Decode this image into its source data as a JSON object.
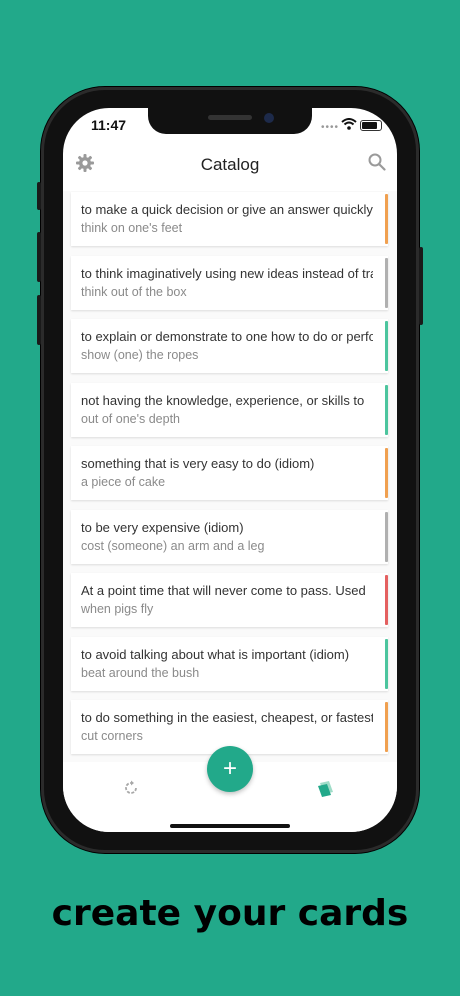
{
  "status_bar": {
    "time": "11:47",
    "signal_dots": "••••"
  },
  "header": {
    "title": "Catalog",
    "settings_icon": "gear-icon",
    "search_icon": "search-icon"
  },
  "cards": [
    {
      "definition": "to make a quick decision or give an answer quickly",
      "term": "think on one's feet",
      "color": "#f0a050"
    },
    {
      "definition": "to think imaginatively using new ideas instead of traditional ones",
      "term": "think out of the box",
      "color": "#b0b0b0"
    },
    {
      "definition": "to explain or demonstrate to one how to do or perform",
      "term": "show (one) the ropes",
      "color": "#4cc59e"
    },
    {
      "definition": "not having the knowledge, experience, or skills to",
      "term": "out of one's depth",
      "color": "#4cc59e"
    },
    {
      "definition": "something that is very easy to do (idiom)",
      "term": "a piece of cake",
      "color": "#f0a050"
    },
    {
      "definition": "to be very expensive (idiom)",
      "term": "cost (someone) an arm and a leg",
      "color": "#b0b0b0"
    },
    {
      "definition": "At a point time that will never come to pass. Used",
      "term": "when pigs fly",
      "color": "#e46060"
    },
    {
      "definition": "to avoid talking about what is important (idiom)",
      "term": "beat around the bush",
      "color": "#4cc59e"
    },
    {
      "definition": "to do something in the easiest, cheapest, or fastest way",
      "term": "cut corners",
      "color": "#f0a050"
    },
    {
      "definition": "",
      "term": "",
      "color": "#b0b0b0"
    }
  ],
  "fab": {
    "label": "+"
  },
  "tabbar": {
    "left_icon": "refresh-icon",
    "right_icon": "cards-icon"
  },
  "caption": "create your cards",
  "colors": {
    "brand": "#22a98a"
  }
}
